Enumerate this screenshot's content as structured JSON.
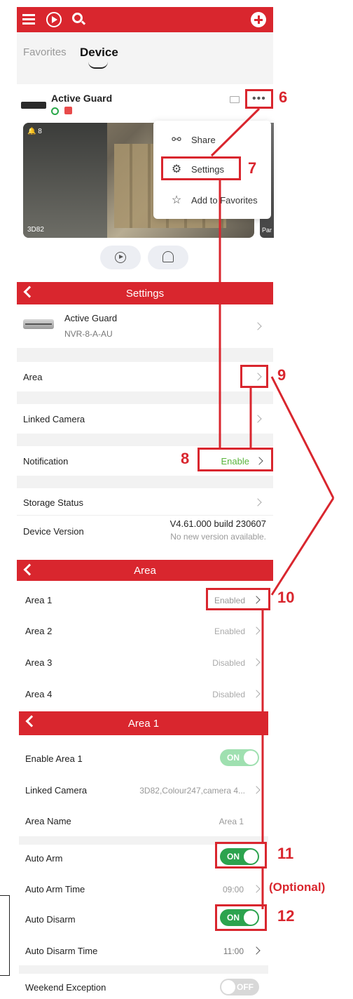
{
  "tabs": {
    "favorites": "Favorites",
    "device": "Device"
  },
  "device_card": {
    "name": "Active Guard",
    "preview_label": "3D82",
    "preview_overlay": "8",
    "side_preview_label": "Par",
    "more": "•••"
  },
  "popup_menu": {
    "share": "Share",
    "settings": "Settings",
    "favorites": "Add to Favorites"
  },
  "settings": {
    "title": "Settings",
    "device_name": "Active Guard",
    "device_model": "NVR-8-A-AU",
    "area": "Area",
    "linked_camera": "Linked Camera",
    "notification": "Notification",
    "notification_value": "Enable",
    "storage_status": "Storage Status",
    "device_version": "Device Version",
    "version_value": "V4.61.000 build 230607",
    "version_note": "No new version available."
  },
  "area_list": {
    "title": "Area",
    "items": [
      {
        "label": "Area 1",
        "status": "Enabled"
      },
      {
        "label": "Area 2",
        "status": "Enabled"
      },
      {
        "label": "Area 3",
        "status": "Disabled"
      },
      {
        "label": "Area 4",
        "status": "Disabled"
      }
    ]
  },
  "area1": {
    "title": "Area 1",
    "enable_label": "Enable Area 1",
    "enable_state": "ON",
    "linked_camera_label": "Linked Camera",
    "linked_camera_value": "3D82,Colour247,camera 4...",
    "area_name_label": "Area Name",
    "area_name_value": "Area 1",
    "auto_arm_label": "Auto Arm",
    "auto_arm_state": "ON",
    "auto_arm_time_label": "Auto Arm Time",
    "auto_arm_time_value": "09:00",
    "auto_disarm_label": "Auto Disarm",
    "auto_disarm_state": "ON",
    "auto_disarm_time_label": "Auto Disarm Time",
    "auto_disarm_time_value": "11:00",
    "weekend_label": "Weekend Exception",
    "weekend_state": "OFF"
  },
  "annotations": {
    "n6": "6",
    "n7": "7",
    "n8": "8",
    "n9": "9",
    "n10": "10",
    "n11": "11",
    "n12": "12",
    "optional": "(Optional)"
  },
  "colors": {
    "accent_red": "#d9262e",
    "toggle_green": "#2ca34e",
    "enable_green": "#5ab43c"
  }
}
